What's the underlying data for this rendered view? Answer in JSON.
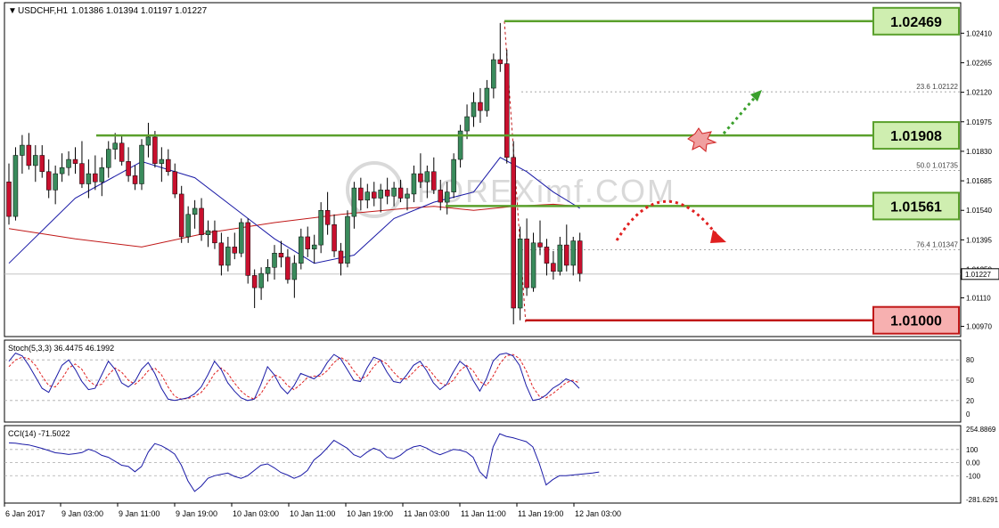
{
  "header": {
    "symbol": "USDCHF,H1",
    "ohlc": "1.01386 1.01394 1.01197 1.01227"
  },
  "watermark": "FOREXimf.COM",
  "colors": {
    "bull": "#3a8b5c",
    "bear": "#c8102e",
    "ma_fast": "#1a1aa6",
    "ma_slow": "#c01818",
    "level_green": "#5aa02c",
    "level_red": "#c01818",
    "box_green": "#cfeeb0",
    "box_red": "#f7b0b0",
    "stoch_main": "#1a1aa6",
    "stoch_signal": "#e02020",
    "cci": "#1a1aa6",
    "arrow_up": "#3aa02c",
    "arrow_down": "#e02020"
  },
  "chart_data": [
    {
      "type": "candlestick",
      "title": "USDCHF,H1",
      "ylim": [
        1.0092,
        1.0256
      ],
      "price_ticks": [
        "1.02410",
        "1.02265",
        "1.02120",
        "1.01975",
        "1.01830",
        "1.01685",
        "1.01540",
        "1.01395",
        "1.01250",
        "1.01110",
        "1.00970"
      ],
      "current_price": "1.01227",
      "x_labels": [
        "6 Jan 2017",
        "9 Jan 03:00",
        "9 Jan 11:00",
        "9 Jan 19:00",
        "10 Jan 03:00",
        "10 Jan 11:00",
        "10 Jan 19:00",
        "11 Jan 03:00",
        "11 Jan 11:00",
        "11 Jan 19:00",
        "12 Jan 03:00"
      ],
      "candles": [
        [
          1.0168,
          1.0177,
          1.0147,
          1.0151
        ],
        [
          1.0151,
          1.0185,
          1.0149,
          1.0181
        ],
        [
          1.0181,
          1.0191,
          1.0172,
          1.0186
        ],
        [
          1.0186,
          1.0192,
          1.0174,
          1.0176
        ],
        [
          1.0176,
          1.0186,
          1.0168,
          1.0181
        ],
        [
          1.0181,
          1.0186,
          1.017,
          1.0173
        ],
        [
          1.0173,
          1.0179,
          1.016,
          1.0164
        ],
        [
          1.0164,
          1.0176,
          1.0157,
          1.0172
        ],
        [
          1.0172,
          1.0182,
          1.0168,
          1.0175
        ],
        [
          1.0175,
          1.0183,
          1.0171,
          1.0179
        ],
        [
          1.0179,
          1.0185,
          1.0172,
          1.0177
        ],
        [
          1.0177,
          1.0188,
          1.0165,
          1.0167
        ],
        [
          1.0167,
          1.0179,
          1.016,
          1.0172
        ],
        [
          1.0172,
          1.0181,
          1.0164,
          1.0168
        ],
        [
          1.0168,
          1.018,
          1.0161,
          1.0175
        ],
        [
          1.0175,
          1.0188,
          1.017,
          1.0184
        ],
        [
          1.0184,
          1.0192,
          1.0179,
          1.0187
        ],
        [
          1.0187,
          1.0191,
          1.0176,
          1.0178
        ],
        [
          1.0178,
          1.0185,
          1.0168,
          1.0171
        ],
        [
          1.0171,
          1.0176,
          1.0164,
          1.0167
        ],
        [
          1.0167,
          1.0189,
          1.0164,
          1.0186
        ],
        [
          1.0186,
          1.0197,
          1.018,
          1.019
        ],
        [
          1.019,
          1.0193,
          1.0175,
          1.0177
        ],
        [
          1.0177,
          1.0185,
          1.0168,
          1.0179
        ],
        [
          1.0179,
          1.0184,
          1.0171,
          1.0173
        ],
        [
          1.0173,
          1.0177,
          1.016,
          1.0162
        ],
        [
          1.0162,
          1.0166,
          1.0138,
          1.0141
        ],
        [
          1.0141,
          1.0156,
          1.0138,
          1.0152
        ],
        [
          1.0152,
          1.0159,
          1.0145,
          1.0155
        ],
        [
          1.0155,
          1.016,
          1.0139,
          1.0142
        ],
        [
          1.0142,
          1.0149,
          1.0136,
          1.0144
        ],
        [
          1.0144,
          1.0149,
          1.0135,
          1.0138
        ],
        [
          1.0138,
          1.0143,
          1.0122,
          1.0127
        ],
        [
          1.0127,
          1.0141,
          1.0124,
          1.0136
        ],
        [
          1.0136,
          1.0143,
          1.013,
          1.0133
        ],
        [
          1.0133,
          1.015,
          1.0131,
          1.0148
        ],
        [
          1.0148,
          1.015,
          1.0118,
          1.0122
        ],
        [
          1.0122,
          1.0125,
          1.0106,
          1.0116
        ],
        [
          1.0116,
          1.0126,
          1.011,
          1.0123
        ],
        [
          1.0123,
          1.013,
          1.0119,
          1.0126
        ],
        [
          1.0126,
          1.0137,
          1.012,
          1.0133
        ],
        [
          1.0133,
          1.0139,
          1.0126,
          1.0131
        ],
        [
          1.0131,
          1.0135,
          1.0118,
          1.012
        ],
        [
          1.012,
          1.0132,
          1.0111,
          1.0128
        ],
        [
          1.0128,
          1.0145,
          1.0125,
          1.0141
        ],
        [
          1.0141,
          1.0146,
          1.0131,
          1.0135
        ],
        [
          1.0135,
          1.0142,
          1.0128,
          1.0137
        ],
        [
          1.0137,
          1.0158,
          1.0133,
          1.0154
        ],
        [
          1.0154,
          1.0163,
          1.0142,
          1.0147
        ],
        [
          1.0147,
          1.0152,
          1.0131,
          1.0134
        ],
        [
          1.0134,
          1.0138,
          1.0122,
          1.0128
        ],
        [
          1.0128,
          1.0154,
          1.0126,
          1.0151
        ],
        [
          1.0151,
          1.0168,
          1.0145,
          1.0165
        ],
        [
          1.0165,
          1.017,
          1.0154,
          1.0159
        ],
        [
          1.0159,
          1.0167,
          1.0155,
          1.0163
        ],
        [
          1.0163,
          1.0168,
          1.0156,
          1.016
        ],
        [
          1.016,
          1.0167,
          1.0153,
          1.0164
        ],
        [
          1.0164,
          1.017,
          1.0157,
          1.0161
        ],
        [
          1.0161,
          1.0168,
          1.0156,
          1.0165
        ],
        [
          1.0165,
          1.0169,
          1.0158,
          1.016
        ],
        [
          1.016,
          1.0165,
          1.0154,
          1.0162
        ],
        [
          1.0162,
          1.0176,
          1.0158,
          1.0172
        ],
        [
          1.0172,
          1.0182,
          1.0165,
          1.0168
        ],
        [
          1.0168,
          1.0176,
          1.016,
          1.0173
        ],
        [
          1.0173,
          1.018,
          1.0162,
          1.0164
        ],
        [
          1.0164,
          1.0169,
          1.0154,
          1.0158
        ],
        [
          1.0158,
          1.0168,
          1.0152,
          1.0163
        ],
        [
          1.0163,
          1.0182,
          1.016,
          1.0179
        ],
        [
          1.0179,
          1.0196,
          1.0175,
          1.0193
        ],
        [
          1.0193,
          1.0206,
          1.0189,
          1.02
        ],
        [
          1.02,
          1.0212,
          1.0195,
          1.0207
        ],
        [
          1.0207,
          1.0214,
          1.0197,
          1.0203
        ],
        [
          1.0203,
          1.0218,
          1.02,
          1.0214
        ],
        [
          1.0214,
          1.0231,
          1.0209,
          1.0228
        ],
        [
          1.0228,
          1.0246,
          1.0222,
          1.0226
        ],
        [
          1.0226,
          1.0233,
          1.0177,
          1.018
        ],
        [
          1.018,
          1.0188,
          1.0098,
          1.0106
        ],
        [
          1.0106,
          1.0146,
          1.01,
          1.014
        ],
        [
          1.014,
          1.015,
          1.0112,
          1.0116
        ],
        [
          1.0116,
          1.0143,
          1.0114,
          1.0138
        ],
        [
          1.0138,
          1.0149,
          1.0132,
          1.0136
        ],
        [
          1.0136,
          1.014,
          1.0122,
          1.0128
        ],
        [
          1.0128,
          1.0134,
          1.012,
          1.0124
        ],
        [
          1.0124,
          1.0141,
          1.0122,
          1.0137
        ],
        [
          1.0137,
          1.0147,
          1.0124,
          1.0127
        ],
        [
          1.0127,
          1.0141,
          1.0122,
          1.0139
        ],
        [
          1.0139,
          1.0143,
          1.0119,
          1.0123
        ]
      ],
      "ma_fast": [
        [
          0,
          1.0128
        ],
        [
          10,
          1.016
        ],
        [
          20,
          1.0178
        ],
        [
          28,
          1.017
        ],
        [
          34,
          1.0155
        ],
        [
          40,
          1.014
        ],
        [
          46,
          1.0128
        ],
        [
          52,
          1.0132
        ],
        [
          58,
          1.015
        ],
        [
          64,
          1.0158
        ],
        [
          70,
          1.0163
        ],
        [
          74,
          1.018
        ],
        [
          78,
          1.0173
        ],
        [
          82,
          1.0163
        ],
        [
          86,
          1.0155
        ]
      ],
      "ma_slow": [
        [
          0,
          1.0145
        ],
        [
          10,
          1.014
        ],
        [
          20,
          1.0136
        ],
        [
          30,
          1.0143
        ],
        [
          40,
          1.0148
        ],
        [
          50,
          1.0152
        ],
        [
          60,
          1.0155
        ],
        [
          64,
          1.0156
        ],
        [
          70,
          1.0154
        ],
        [
          76,
          1.0156
        ],
        [
          82,
          1.0157
        ],
        [
          86,
          1.0156
        ]
      ],
      "levels": [
        {
          "label": "1.02469",
          "value": 1.02469,
          "kind": "resistance"
        },
        {
          "label": "1.01908",
          "value": 1.01908,
          "kind": "resistance"
        },
        {
          "label": "1.01561",
          "value": 1.01561,
          "kind": "support"
        },
        {
          "label": "1.01000",
          "value": 1.01,
          "kind": "support-red"
        }
      ],
      "fib_levels": [
        {
          "label": "23.6  1.02122",
          "value": 1.02122
        },
        {
          "label": "50.0  1.01735",
          "value": 1.01735
        },
        {
          "label": "76.4  1.01347",
          "value": 1.01347
        }
      ]
    },
    {
      "type": "line",
      "title": "Stoch(5,3,3) 36.4475 46.1992",
      "ylim": [
        0,
        100
      ],
      "ticks": [
        "80",
        "50",
        "20",
        "0"
      ],
      "series": [
        {
          "name": "main",
          "values": [
            78,
            90,
            86,
            72,
            55,
            38,
            32,
            52,
            72,
            80,
            66,
            48,
            36,
            38,
            58,
            78,
            66,
            46,
            40,
            48,
            66,
            76,
            60,
            38,
            22,
            20,
            22,
            24,
            30,
            40,
            58,
            78,
            66,
            46,
            34,
            24,
            20,
            22,
            44,
            70,
            58,
            40,
            30,
            42,
            60,
            56,
            52,
            60,
            76,
            88,
            82,
            66,
            50,
            48,
            68,
            84,
            80,
            62,
            48,
            46,
            58,
            72,
            78,
            64,
            46,
            36,
            44,
            62,
            78,
            70,
            50,
            34,
            52,
            78,
            88,
            90,
            86,
            72,
            42,
            20,
            22,
            28,
            38,
            44,
            52,
            48,
            38
          ]
        },
        {
          "name": "signal",
          "values": [
            70,
            80,
            84,
            82,
            72,
            56,
            42,
            40,
            52,
            68,
            74,
            66,
            50,
            42,
            44,
            58,
            68,
            62,
            50,
            44,
            52,
            64,
            68,
            58,
            40,
            26,
            22,
            23,
            26,
            32,
            44,
            60,
            68,
            60,
            46,
            34,
            26,
            22,
            30,
            46,
            58,
            54,
            42,
            36,
            44,
            54,
            56,
            56,
            64,
            76,
            84,
            78,
            64,
            52,
            56,
            70,
            80,
            74,
            62,
            52,
            52,
            62,
            72,
            70,
            58,
            46,
            42,
            50,
            64,
            72,
            64,
            48,
            42,
            56,
            74,
            86,
            88,
            82,
            64,
            40,
            26,
            24,
            30,
            38,
            46,
            50,
            46
          ]
        }
      ]
    },
    {
      "type": "line",
      "title": "CCI(14) -71.5022",
      "ylim": [
        -281.6291,
        254.8869
      ],
      "ticks": [
        "254.8869",
        "100",
        "0.00",
        "-100",
        "-281.6291"
      ],
      "series": [
        {
          "name": "CCI(14)",
          "values": [
            150,
            148,
            140,
            135,
            122,
            108,
            92,
            75,
            70,
            62,
            68,
            76,
            102,
            86,
            55,
            40,
            10,
            -20,
            -30,
            -70,
            -30,
            80,
            145,
            128,
            100,
            65,
            -20,
            -140,
            -220,
            -180,
            -120,
            -100,
            -90,
            -80,
            -105,
            -120,
            -100,
            -60,
            -20,
            -10,
            -40,
            -75,
            -95,
            -120,
            -100,
            -60,
            20,
            60,
            112,
            170,
            140,
            110,
            60,
            40,
            80,
            110,
            90,
            40,
            30,
            55,
            95,
            120,
            130,
            110,
            80,
            60,
            80,
            100,
            95,
            80,
            40,
            -70,
            -120,
            120,
            220,
            200,
            190,
            175,
            160,
            120,
            -10,
            -170,
            -130,
            -100,
            -100,
            -95,
            -90,
            -85,
            -80,
            -72
          ]
        }
      ]
    }
  ]
}
